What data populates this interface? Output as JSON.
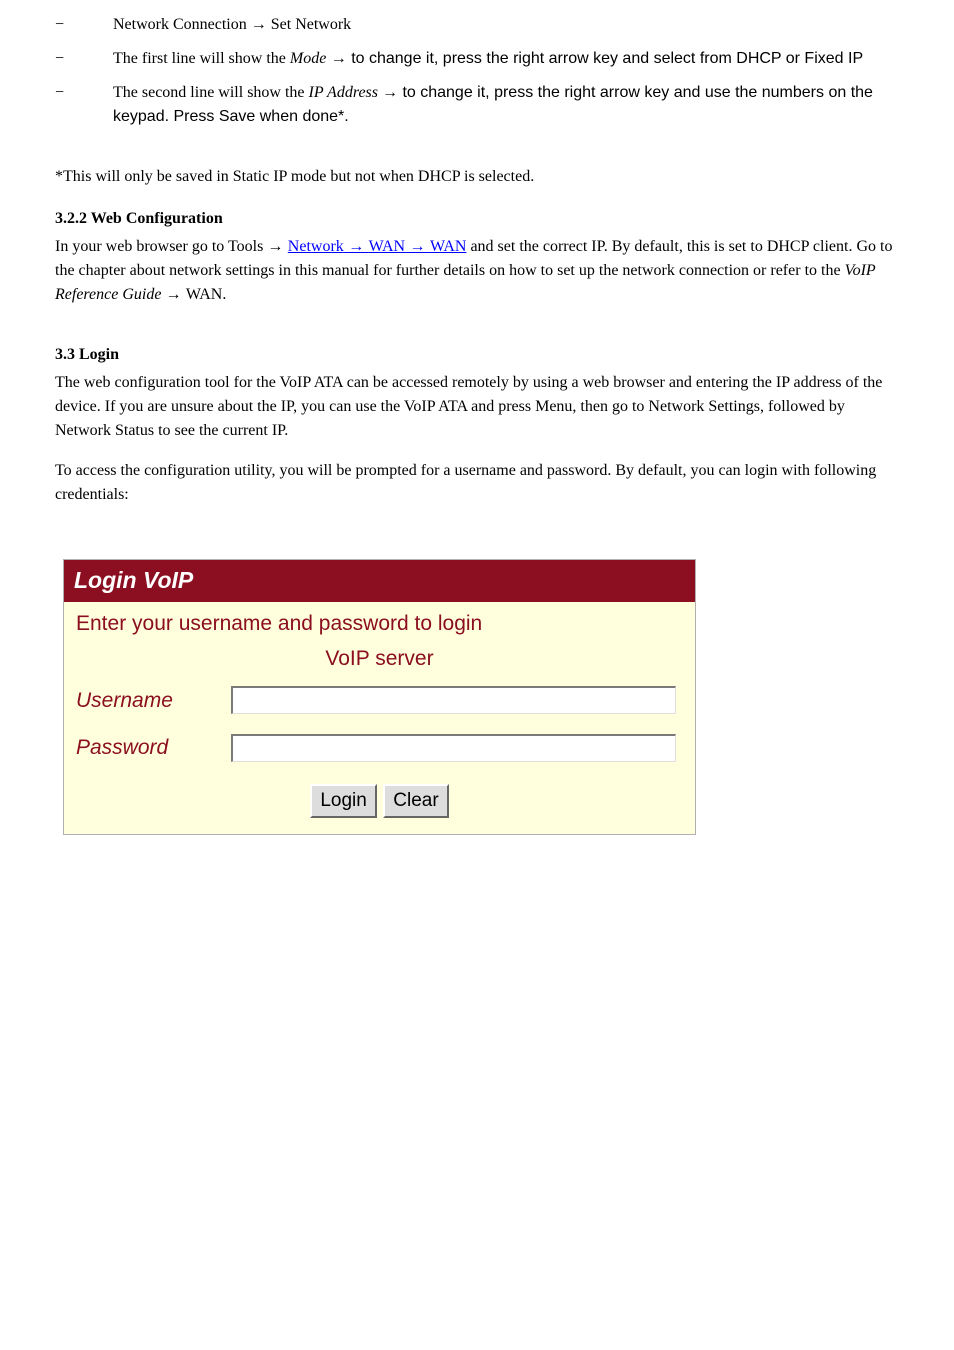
{
  "bullets": {
    "sym1": "−",
    "txt1_a": "Network Connection ",
    "txt1_arrow": "→",
    "txt1_b": " Set Network",
    "sym2": "−",
    "txt2_pre": "The first line will show the ",
    "txt2_em": "Mode",
    "txt2_post": " → to change it, press the right arrow key and select from DHCP or Fixed IP",
    "sym3": "−",
    "txt3_a": "The second line will show the",
    "txt3_em": " IP Address ",
    "txt3_b": "→ to change it, press the right arrow key and use the numbers on the keypad. Press Save when done*."
  },
  "note": "*This will only be saved in Static IP mode but not when DHCP is selected.",
  "h3_1": "3.2.2 Web Configuration",
  "p1": {
    "t1": "In your web browser go to Tools ",
    "arrow1": "→ ",
    "link1": "Network",
    "arrow2": " → ",
    "link2": "WAN",
    "arrow3": " → ",
    "link3": "WAN",
    "t2": " and set the correct IP. By default, this is set to DHCP client. Go to the chapter about network settings in this manual for further details on how to set up the network connection or refer to the",
    "t3": " VoIP Reference Guide ",
    "arrow4": "→ ",
    "t4": "WAN."
  },
  "h3_2": "3.3 Login",
  "p2": "The web configuration tool for the VoIP ATA can be accessed remotely by using a web browser and entering the IP address of the device. If you are unsure about the IP, you can use the VoIP ATA and press Menu, then go to Network Settings, followed by Network Status to see the current IP.",
  "p3": "To access the configuration utility, you will be prompted for a username and password. By default, you can login with following credentials:",
  "login": {
    "header": "Login VoIP",
    "intro": "Enter your username and password to login",
    "sub": "VoIP server",
    "username_label": "Username",
    "username_value": "",
    "password_label": "Password",
    "password_value": "",
    "login_btn": "Login",
    "clear_btn": "Clear"
  }
}
